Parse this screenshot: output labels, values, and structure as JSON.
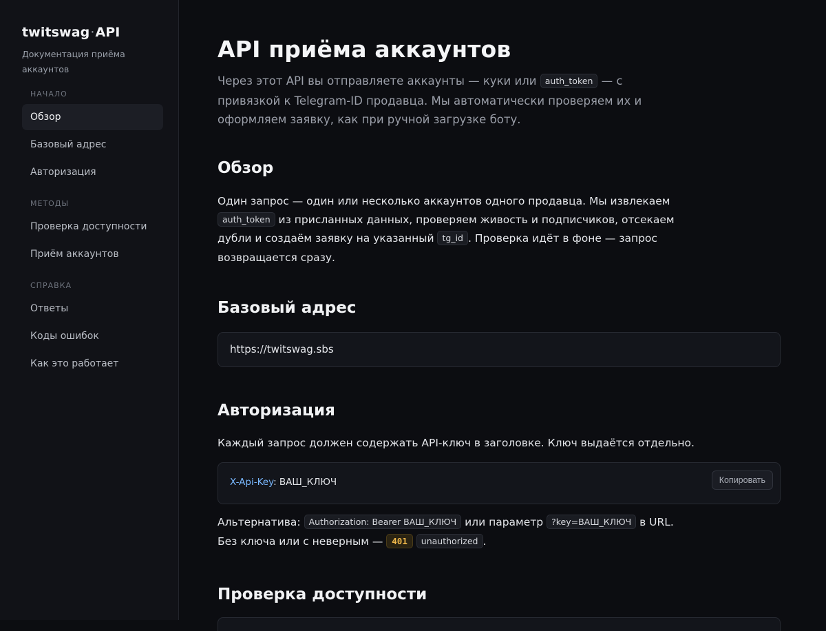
{
  "sidebar": {
    "brand_left": "twitswag",
    "brand_dot": "·",
    "brand_right": "API",
    "subtitle": "Документация приёма аккаунтов",
    "sections": [
      {
        "title": "НАЧАЛО",
        "items": [
          "Обзор",
          "Базовый адрес",
          "Авторизация"
        ]
      },
      {
        "title": "МЕТОДЫ",
        "items": [
          "Проверка доступности",
          "Приём аккаунтов"
        ]
      },
      {
        "title": "СПРАВКА",
        "items": [
          "Ответы",
          "Коды ошибок",
          "Как это работает"
        ]
      }
    ],
    "active_item": "Обзор"
  },
  "page": {
    "title": "API приёма аккаунтов",
    "lead_1": "Через этот API вы отправляете аккаунты — куки или ",
    "lead_code": "auth_token",
    "lead_2": " — с привязкой к Telegram-ID продавца. Мы автоматически проверяем их и оформляем заявку, как при ручной загрузке боту."
  },
  "overview": {
    "heading": "Обзор",
    "text_1": "Один запрос — один или несколько аккаунтов одного продавца. Мы извлекаем ",
    "code_1": "auth_token",
    "text_2": " из присланных данных, проверяем живость и подписчиков, отсекаем дубли и создаём заявку на указанный ",
    "code_2": "tg_id",
    "text_3": ". Проверка идёт в фоне — запрос возвращается сразу."
  },
  "base_url": {
    "heading": "Базовый адрес",
    "url": "https://twitswag.sbs"
  },
  "auth": {
    "heading": "Авторизация",
    "text": "Каждый запрос должен содержать API-ключ в заголовке. Ключ выдаётся отдельно.",
    "header_name": "X-Api-Key",
    "header_sep": ": ",
    "header_value": "ВАШ_КЛЮЧ",
    "copy_label": "Копировать",
    "alt_1": "Альтернатива: ",
    "alt_code_1": "Authorization: Bearer ВАШ_КЛЮЧ",
    "alt_2": " или параметр ",
    "alt_code_2": "?key=ВАШ_КЛЮЧ",
    "alt_3": " в URL. Без ключа или с неверным — ",
    "alt_status": "401",
    "alt_4": " ",
    "alt_code_3": "unauthorized",
    "alt_5": "."
  },
  "availability": {
    "heading": "Проверка доступности"
  },
  "colors": {
    "background": "#0c0d11",
    "sidebar": "#111217",
    "accent_key": "#79b8ff",
    "status_401": "#f0b84a"
  }
}
